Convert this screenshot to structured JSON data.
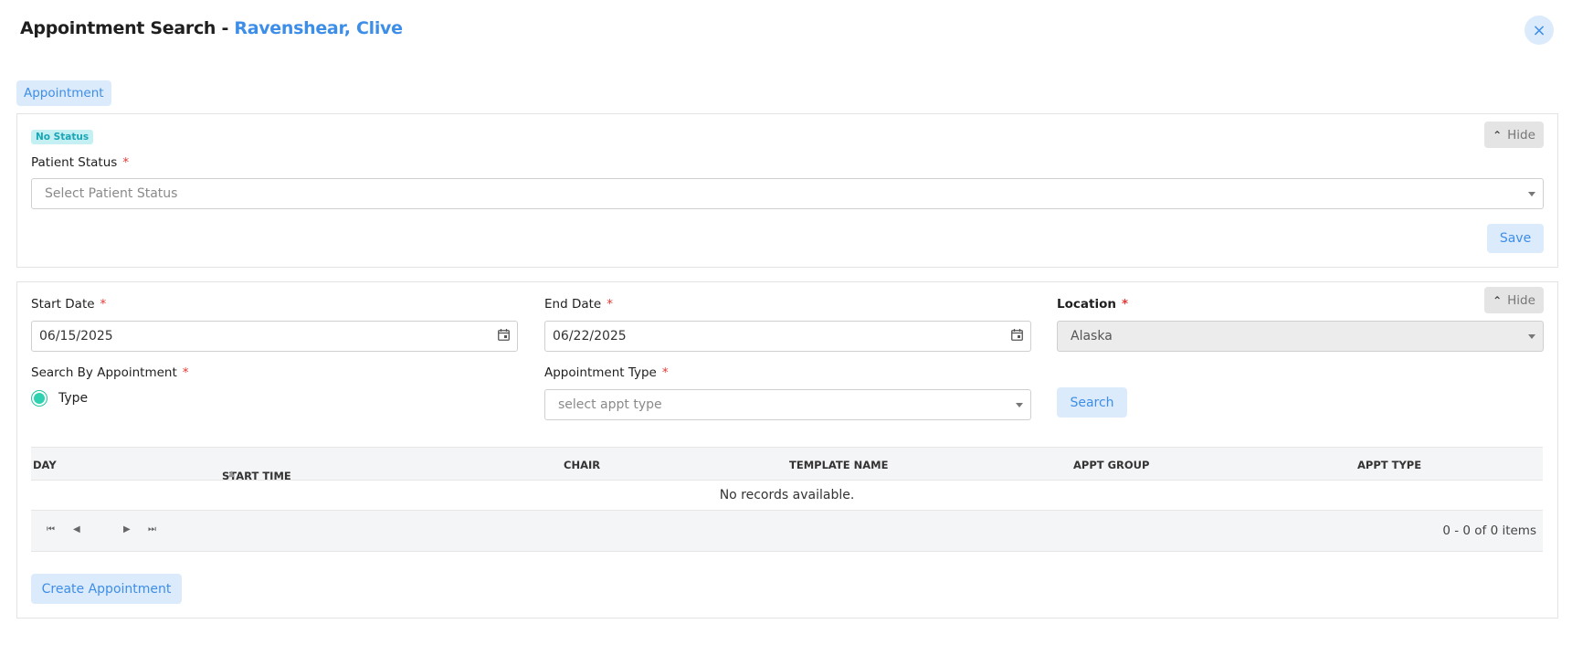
{
  "header": {
    "title_prefix": "Appointment Search - ",
    "patient_name": "Ravenshear, Clive",
    "close_icon": "×"
  },
  "tabs": [
    {
      "label": "Appointment"
    }
  ],
  "status_panel": {
    "badge": "No Status",
    "hide_label": "Hide",
    "patient_status": {
      "label": "Patient Status",
      "required": "*",
      "placeholder": "Select Patient Status"
    },
    "save_label": "Save"
  },
  "search_panel": {
    "hide_label": "Hide",
    "start_date": {
      "label": "Start Date",
      "required": "*",
      "value": "06/15/2025"
    },
    "end_date": {
      "label": "End Date",
      "required": "*",
      "value": "06/22/2025"
    },
    "location": {
      "label": "Location",
      "required": "*",
      "value": "Alaska"
    },
    "search_by": {
      "label": "Search By Appointment",
      "required": "*",
      "option": "Type"
    },
    "appt_type": {
      "label": "Appointment Type",
      "required": "*",
      "placeholder": "select appt type"
    },
    "search_label": "Search"
  },
  "grid": {
    "columns": [
      "DAY",
      "START TIME",
      "CHAIR",
      "TEMPLATE NAME",
      "APPT GROUP",
      "APPT TYPE"
    ],
    "empty_message": "No records available.",
    "pager_summary": "0 - 0 of 0 items"
  },
  "create_label": "Create Appointment",
  "colors": {
    "accent": "#3d8ee8",
    "accent_bg": "#dcebfb",
    "radio": "#2fd1b0",
    "required": "#e53935"
  }
}
